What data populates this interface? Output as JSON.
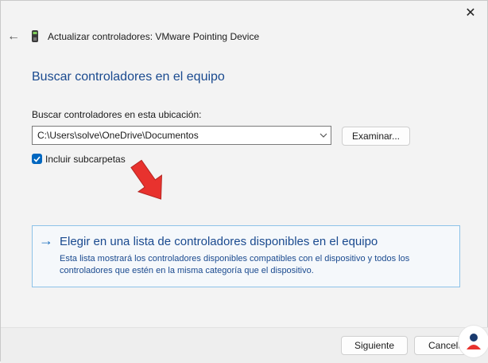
{
  "window": {
    "title": "Actualizar controladores: VMware Pointing Device",
    "close_glyph": "✕",
    "back_glyph": "←"
  },
  "content": {
    "section_title": "Buscar controladores en el equipo",
    "path_label": "Buscar controladores en esta ubicación:",
    "path_value": "C:\\Users\\solve\\OneDrive\\Documentos",
    "browse_label": "Examinar...",
    "include_subfolders_label": "Incluir subcarpetas",
    "include_subfolders_checked": true,
    "choose_title": "Elegir en una lista de controladores disponibles en el equipo",
    "choose_description": "Esta lista mostrará los controladores disponibles compatibles con el dispositivo y todos los controladores que estén en la misma categoría que el dispositivo."
  },
  "footer": {
    "next_label": "Siguiente",
    "cancel_label": "Cancelar"
  },
  "icons": {
    "device": "device-icon",
    "annotation_arrow": "red-arrow-icon",
    "watermark": "logo-icon"
  },
  "colors": {
    "accent": "#0067c0",
    "link": "#1a4a8f",
    "annotation": "#e8322e"
  }
}
